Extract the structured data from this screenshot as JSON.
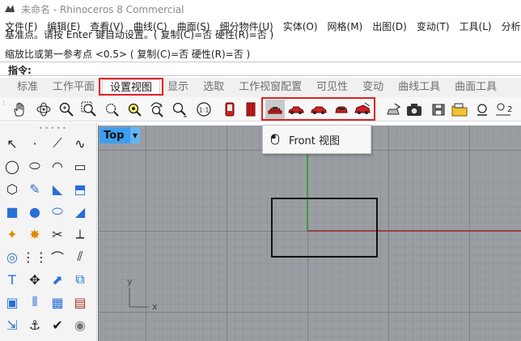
{
  "window": {
    "title": "未命名 - Rhinoceros 8 Commercial"
  },
  "menubar": {
    "items": [
      "文件(F)",
      "编辑(E)",
      "查看(V)",
      "曲线(C)",
      "曲面(S)",
      "细分物件(U)",
      "实体(O)",
      "网格(M)",
      "出图(D)",
      "变动(T)",
      "工具(L)",
      "分析"
    ]
  },
  "command": {
    "line1": "基准点。请按 Enter 键自动设置。( 复制(C)=否  硬性(R)=否 )",
    "line2": "缩放比或第一参考点 <0.5> ( 复制(C)=否  硬性(R)=否 )",
    "prompt": "指令:"
  },
  "tabs": {
    "items": [
      "标准",
      "工作平面",
      "设置视图",
      "显示",
      "选取",
      "工作视窗配置",
      "可见性",
      "变动",
      "曲线工具",
      "曲面工具"
    ],
    "active_index": 2
  },
  "toolbar": {
    "icons": [
      "pan-hand-icon",
      "rotate-view-icon",
      "zoom-icon",
      "zoom-window-icon",
      "zoom-extents-icon",
      "zoom-selected-icon",
      "zoom-dynamic-icon",
      "zoom-all-icon",
      "zoom-1to1-icon",
      "phone-view-icon",
      "door-view-icon",
      "car-top-view-icon",
      "car-front-view-icon",
      "car-right-view-icon",
      "car-back-view-icon",
      "car-perspective-view-icon",
      "named-view-icon",
      "camera-icon",
      "save-view-icon",
      "restore-view-icon",
      "light-icon",
      "two-view-icon"
    ]
  },
  "left_tools": {
    "icons": [
      "select-arrow-icon",
      "point-icon",
      "polyline-icon",
      "curve-icon",
      "circle-icon",
      "ellipse-icon",
      "arc-icon",
      "rectangle-icon",
      "polygon-icon",
      "freeform-icon",
      "surface-icon",
      "extrude-surface-icon",
      "box-icon",
      "sphere-icon",
      "cylinder-icon",
      "patch-icon",
      "gear-icon",
      "explode-icon",
      "trim-icon",
      "split-icon",
      "boolean-icon",
      "array-icon",
      "fillet-icon",
      "offset-icon",
      "text-icon",
      "move-icon",
      "transform-icon",
      "copy-icon",
      "cube-icon",
      "bars-icon",
      "grid-icon",
      "layer-icon",
      "scale-icon",
      "anchor-icon",
      "check-icon",
      "render-icon"
    ]
  },
  "viewport": {
    "name": "Top",
    "axis_x_label": "x",
    "axis_y_label": "y"
  },
  "popup": {
    "label": "Front 视图"
  },
  "colors": {
    "highlight": "#e02020",
    "viewport_bg": "#9a9ea3",
    "grid_minor": "#8d9197",
    "grid_major": "#7b7f84",
    "axis_x": "#9a2a2a",
    "axis_y": "#2a9a2a",
    "viewport_tab": "#3d9ff0"
  }
}
